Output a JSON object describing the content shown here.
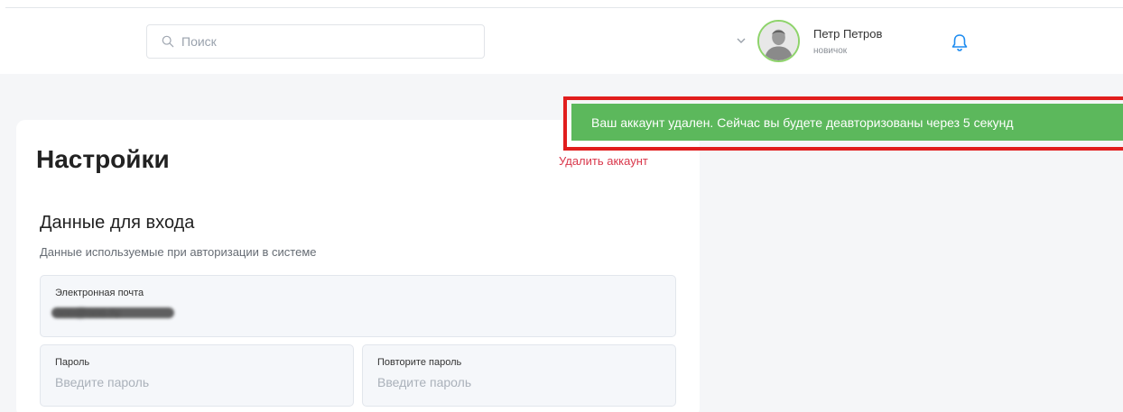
{
  "header": {
    "search": {
      "placeholder": "Поиск",
      "value": ""
    },
    "user": {
      "name": "Петр Петров",
      "role": "новичок"
    }
  },
  "toast": {
    "message": "Ваш аккаунт удален. Сейчас вы будете деавторизованы через 5 секунд",
    "color": "#5cb85c",
    "highlight_color": "#e11d1d"
  },
  "settings": {
    "title": "Настройки",
    "delete_account_label": "Удалить аккаунт",
    "login_section": {
      "title": "Данные для входа",
      "subtitle": "Данные используемые при авторизации в системе",
      "email": {
        "label": "Электронная почта",
        "value": "ооо@ооо.ru"
      },
      "password": {
        "label": "Пароль",
        "placeholder": "Введите пароль"
      },
      "password_repeat": {
        "label": "Повторите пароль",
        "placeholder": "Введите пароль"
      }
    }
  },
  "icons": {
    "search": "search-icon",
    "chevron": "chevron-down-icon",
    "avatar": "user-avatar",
    "bell": "bell-icon"
  }
}
